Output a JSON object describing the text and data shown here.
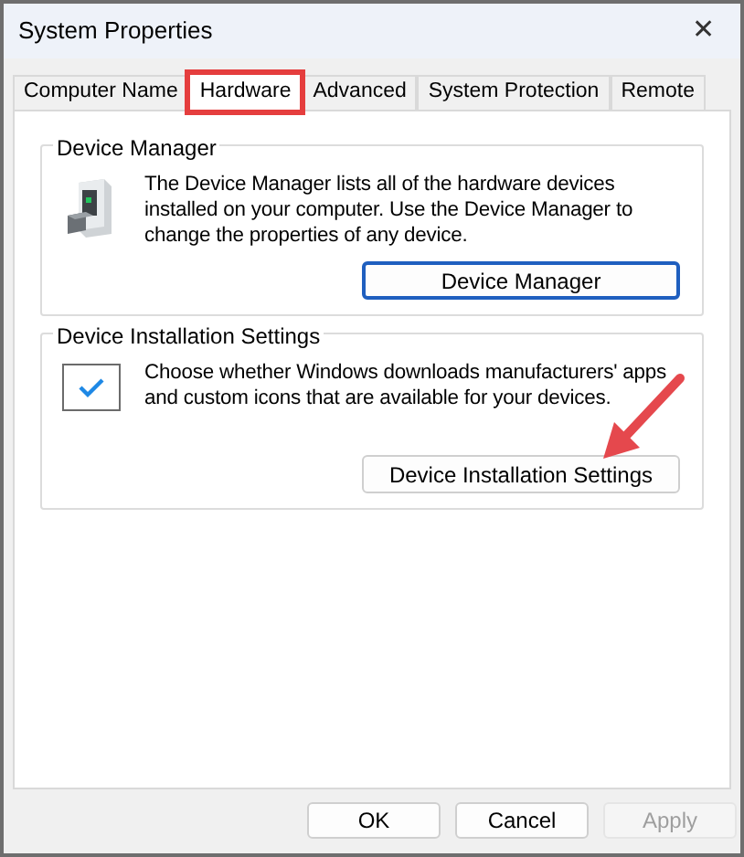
{
  "window": {
    "title": "System Properties",
    "close": "✕"
  },
  "tabs": [
    {
      "label": "Computer Name",
      "selected": false,
      "highlighted": false
    },
    {
      "label": "Hardware",
      "selected": true,
      "highlighted": true
    },
    {
      "label": "Advanced",
      "selected": false,
      "highlighted": false
    },
    {
      "label": "System Protection",
      "selected": false,
      "highlighted": false
    },
    {
      "label": "Remote",
      "selected": false,
      "highlighted": false
    }
  ],
  "groups": [
    {
      "title": "Device Manager",
      "kind": "device",
      "text": "The Device Manager lists all of the hardware devices installed on your computer. Use the Device Manager to change the properties of any device.",
      "button": "Device Manager",
      "button_focused": true,
      "annotated": false
    },
    {
      "title": "Device Installation Settings",
      "kind": "check",
      "text": "Choose whether Windows downloads manufacturers' apps and custom icons that are available for your devices.",
      "button": "Device Installation Settings",
      "button_focused": false,
      "annotated": true
    }
  ],
  "buttons": [
    {
      "label": "OK",
      "disabled": false
    },
    {
      "label": "Cancel",
      "disabled": false
    },
    {
      "label": "Apply",
      "disabled": true
    }
  ]
}
